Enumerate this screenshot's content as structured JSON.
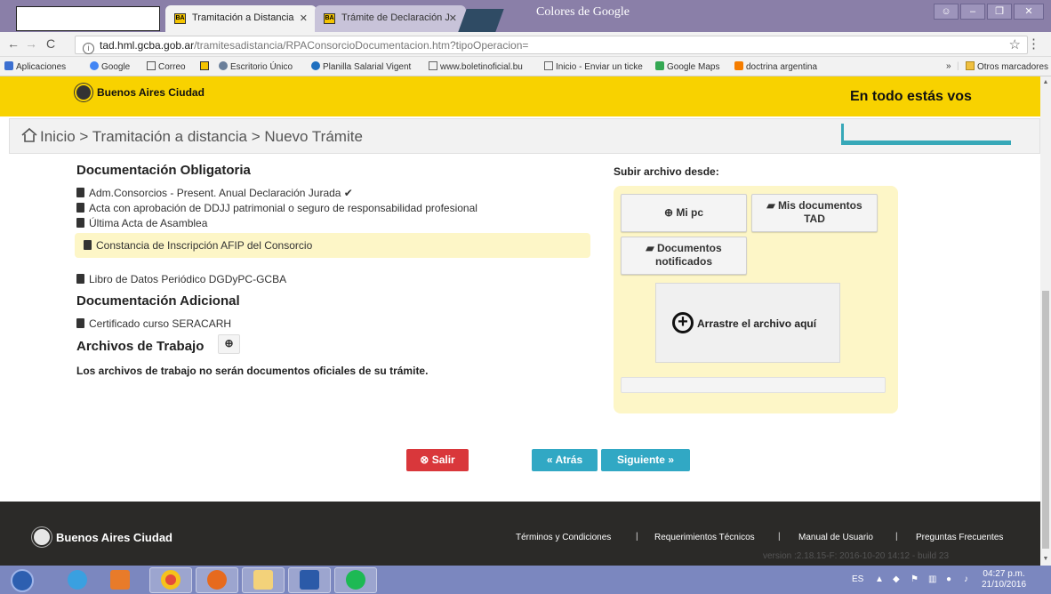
{
  "browser": {
    "window_title": "Colores de Google",
    "tabs": [
      {
        "label": "Tramitación a Distancia",
        "active": true
      },
      {
        "label": "Trámite de Declaración J",
        "active": false
      }
    ],
    "url_host": "tad.hml.gcba.gob.ar",
    "url_path": "/tramitesadistancia/RPAConsorcioDocumentacion.htm?tipoOperacion=",
    "bookmarks": [
      {
        "label": "Aplicaciones",
        "icon": "apps-grid-icon"
      },
      {
        "label": "Google",
        "icon": "google-icon"
      },
      {
        "label": "Correo",
        "icon": "mail-icon"
      },
      {
        "label": "",
        "icon": "ba-logo-icon"
      },
      {
        "label": "Escritorio Único",
        "icon": "escritorio-icon"
      },
      {
        "label": "Planilla Salarial Vigent",
        "icon": "planilla-icon"
      },
      {
        "label": "www.boletinoficial.bu",
        "icon": "page-icon"
      },
      {
        "label": "Inicio - Enviar un ticke",
        "icon": "page-icon"
      },
      {
        "label": "Google Maps",
        "icon": "maps-icon"
      },
      {
        "label": "doctrina argentina",
        "icon": "blogger-icon"
      }
    ],
    "bookmarks_overflow": "»",
    "other_bookmarks": "Otros marcadores"
  },
  "header": {
    "logo_text": "Buenos Aires Ciudad",
    "slogan": "En todo estás vos"
  },
  "breadcrumb": {
    "home": "Inicio",
    "sep1": ">",
    "item1": "Tramitación a distancia",
    "sep2": ">",
    "item2": "Nuevo Trámite"
  },
  "docs": {
    "obligatoria_title": "Documentación Obligatoria",
    "obligatoria_items": [
      "Adm.Consorcios - Present. Anual Declaración Jurada ✔",
      "Acta con aprobación de DDJJ patrimonial o seguro de responsabilidad profesional",
      "Última Acta de Asamblea",
      "Constancia de Inscripción AFIP del Consorcio",
      "Libro de Datos Periódico DGDyPC-GCBA"
    ],
    "adicional_title": "Documentación Adicional",
    "adicional_items": [
      "Certificado curso SERACARH"
    ],
    "trabajo_title": "Archivos de Trabajo",
    "trabajo_add": "⊕",
    "trabajo_note": "Los archivos de trabajo no serán documentos oficiales de su trámite."
  },
  "upload": {
    "label": "Subir archivo desde:",
    "mi_pc": "⊕ Mi pc",
    "mis_documentos_line1": "Mis documentos",
    "mis_documentos_line2": "TAD",
    "notificados_line1": "Documentos",
    "notificados_line2": "notificados",
    "dropzone_text": "Arrastre el archivo aquí"
  },
  "actions": {
    "salir": "Salir",
    "atras": "Atrás",
    "siguiente": "Siguiente"
  },
  "footer": {
    "logo_text": "Buenos Aires Ciudad",
    "links": [
      "Términos y Condiciones",
      "Requerimientos Técnicos",
      "Manual de Usuario",
      "Preguntas Frecuentes"
    ],
    "separator": "|",
    "version": "version :2.18.15-F: 2016-10-20 14:12 - build 23"
  },
  "taskbar": {
    "lang": "ES",
    "time": "04:27 p.m.",
    "date": "21/10/2016"
  },
  "colors": {
    "brand_yellow": "#f8d200",
    "accent_teal": "#31a8c4",
    "danger_red": "#d9373b",
    "footer_dark": "#2b2a28"
  }
}
